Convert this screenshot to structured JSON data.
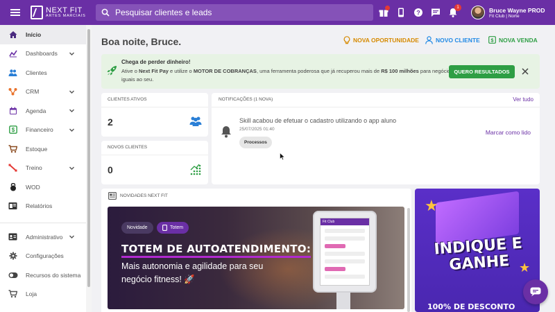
{
  "header": {
    "logo_line1": "NEXT FIT",
    "logo_line2": "ARTES MARCIAIS",
    "search_placeholder": "Pesquisar clientes e leads",
    "notifications_count": "1",
    "user_name": "Bruce Wayne PROD",
    "user_org": "Fit Club | Norte",
    "icons": [
      "menu-icon",
      "search-icon",
      "gift-icon",
      "phone-icon",
      "help-icon",
      "chat-icon",
      "bell-icon"
    ]
  },
  "sidebar": {
    "items": [
      {
        "label": "Início",
        "icon": "home-icon",
        "active": true
      },
      {
        "label": "Dashboards",
        "icon": "chart-line-icon",
        "chevron": true
      },
      {
        "label": "Clientes",
        "icon": "users-icon"
      },
      {
        "label": "CRM",
        "icon": "crm-icon",
        "chevron": true
      },
      {
        "label": "Agenda",
        "icon": "calendar-icon",
        "chevron": true
      },
      {
        "label": "Financeiro",
        "icon": "dollar-icon",
        "chevron": true
      },
      {
        "label": "Estoque",
        "icon": "cart-icon"
      },
      {
        "label": "Treino",
        "icon": "training-icon",
        "chevron": true
      },
      {
        "label": "WOD",
        "icon": "kettlebell-icon"
      },
      {
        "label": "Relatórios",
        "icon": "report-icon"
      }
    ],
    "admin_items": [
      {
        "label": "Administrativo",
        "icon": "id-card-icon",
        "chevron": true
      },
      {
        "label": "Configurações",
        "icon": "gear-icon"
      },
      {
        "label": "Recursos do sistema",
        "icon": "toggle-icon"
      },
      {
        "label": "Loja",
        "icon": "store-icon"
      }
    ]
  },
  "main": {
    "greeting": "Boa noite, Bruce.",
    "actions": {
      "opportunity": "NOVA OPORTUNIDADE",
      "client": "NOVO CLIENTE",
      "sale": "NOVA VENDA"
    },
    "banner": {
      "title": "Chega de perder dinheiro!",
      "text_1": "Ative o ",
      "text_brand": "Next Fit Pay",
      "text_2": " e utilize o ",
      "text_motor": "MOTOR DE COBRANÇAS",
      "text_3": ", uma ferramenta poderosa que já recuperou mais de ",
      "text_amount": "R$ 100 milhões",
      "text_4": " para negócios iguais ao seu.",
      "button": "QUERO RESULTADOS"
    },
    "stats": {
      "active_label": "CLIENTES ATIVOS",
      "active_value": "2",
      "new_label": "NOVOS CLIENTES",
      "new_value": "0"
    },
    "notifications": {
      "label": "NOTIFICAÇÕES (1 NOVA)",
      "see_all": "Ver tudo",
      "message": "Skill acabou de efetuar o cadastro utilizando o app aluno",
      "date": "25/07/2025 01:40",
      "chip": "Processos",
      "mark_read": "Marcar como lido"
    },
    "news": {
      "label": "NOVIDADES NEXT FIT",
      "chip_1": "Novidade",
      "chip_2": "Totem",
      "title": "TOTEM DE AUTOATENDIMENTO:",
      "subtitle": "Mais autonomia e agilidade para seu negócio fitness! 🚀",
      "kiosk_header": "Fit Club"
    },
    "referral": {
      "title_line1": "INDIQUE E",
      "title_line2": "GANHE",
      "footer": "100% DE DESCONTO"
    }
  },
  "colors": {
    "brand": "#6a2fa5",
    "green": "#2e9e44",
    "orange": "#d68a00",
    "blue": "#1e88e5"
  }
}
